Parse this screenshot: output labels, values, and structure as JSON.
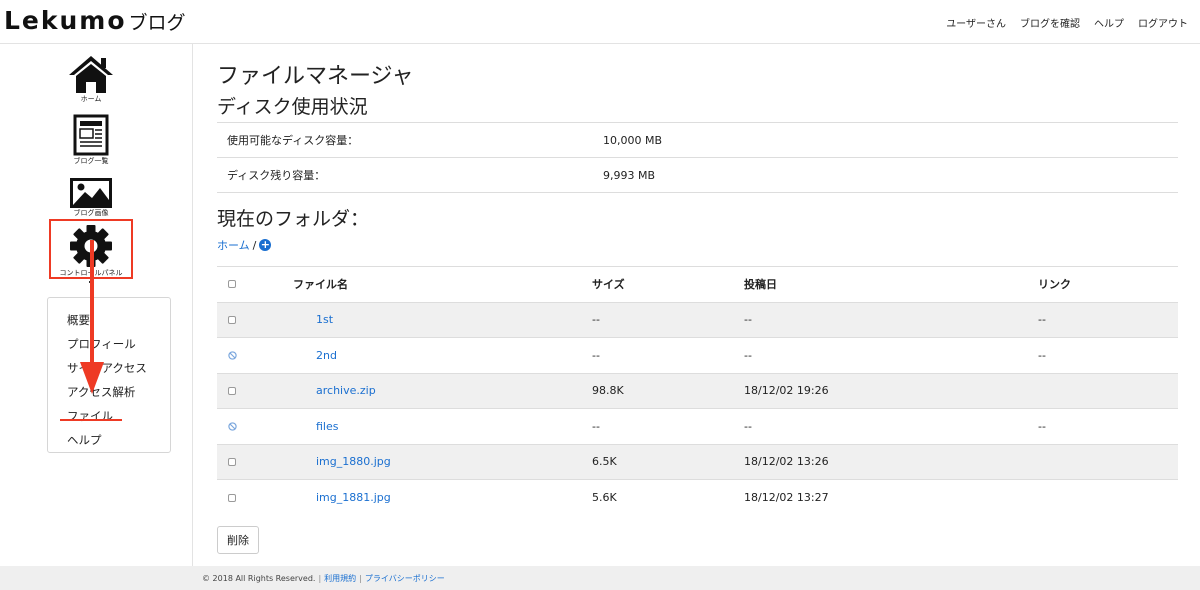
{
  "header": {
    "logo_main": "Lekumo",
    "logo_sub": "ブログ",
    "nav": [
      "ユーザーさん",
      "ブログを確認",
      "ヘルプ",
      "ログアウト"
    ]
  },
  "sidebar": {
    "icons": [
      {
        "label": "ホーム",
        "icon": "home-icon"
      },
      {
        "label": "ブログ一覧",
        "icon": "document-icon"
      },
      {
        "label": "ブログ画像",
        "icon": "image-icon"
      },
      {
        "label": "コントロールパネル",
        "icon": "gear-icon"
      }
    ],
    "submenu": [
      "概要",
      "プロフィール",
      "サイトアクセス",
      "アクセス解析",
      "ファイル",
      "ヘルプ"
    ]
  },
  "main": {
    "title": "ファイルマネージャ",
    "disk_heading": "ディスク使用状況",
    "disk_rows": [
      {
        "label": "使用可能なディスク容量：",
        "value": "10,000 MB"
      },
      {
        "label": "ディスク残り容量：",
        "value": "9,993 MB"
      }
    ],
    "folder_heading": "現在のフォルダ：",
    "breadcrumb": {
      "home": "ホーム",
      "sep": "/"
    },
    "table": {
      "headers": {
        "name": "ファイル名",
        "size": "サイズ",
        "date": "投稿日",
        "link": "リンク"
      },
      "rows": [
        {
          "type": "folder",
          "name": "1st",
          "size": "--",
          "date": "--",
          "link": "--"
        },
        {
          "type": "folder-locked",
          "name": "2nd",
          "size": "--",
          "date": "--",
          "link": "--"
        },
        {
          "type": "file",
          "name": "archive.zip",
          "size": "98.8K",
          "date": "18/12/02 19:26",
          "link": ""
        },
        {
          "type": "folder-locked",
          "name": "files",
          "size": "--",
          "date": "--",
          "link": "--"
        },
        {
          "type": "file",
          "name": "img_1880.jpg",
          "size": "6.5K",
          "date": "18/12/02 13:26",
          "link": ""
        },
        {
          "type": "file",
          "name": "img_1881.jpg",
          "size": "5.6K",
          "date": "18/12/02 13:27",
          "link": ""
        }
      ]
    },
    "delete_label": "削除"
  },
  "footer": {
    "copyright": "© 2018 All Rights Reserved.",
    "links": [
      "利用規約",
      "プライバシーポリシー"
    ],
    "separator": "|"
  },
  "colors": {
    "accent": "#1a6fd0",
    "annotation": "#ee3a24",
    "stripe": "#f0f0f0"
  }
}
